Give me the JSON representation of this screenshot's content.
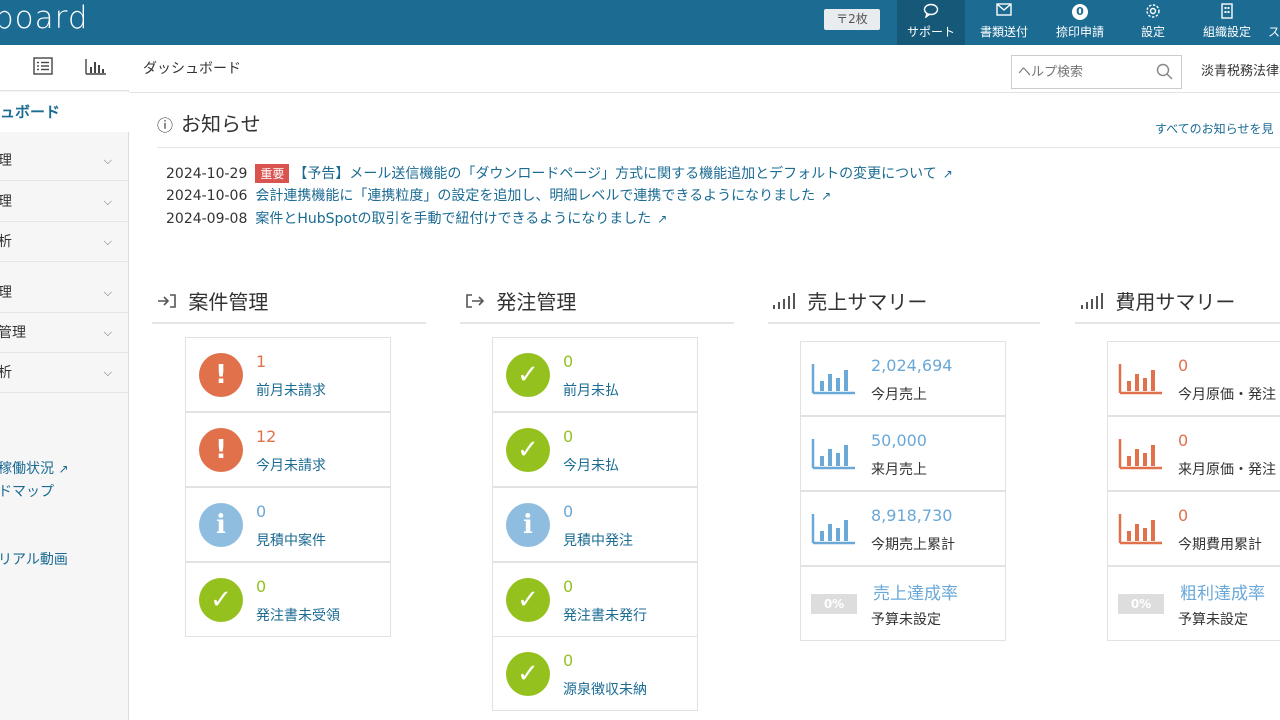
{
  "header": {
    "logo": "board",
    "stamp_chip": "〒2枚",
    "nav": [
      {
        "label": "サポート",
        "icon": "chat-icon"
      },
      {
        "label": "書類送付",
        "icon": "mail-icon"
      },
      {
        "label": "捺印申請",
        "badge": "0"
      },
      {
        "label": "設定",
        "icon": "gear-icon"
      },
      {
        "label": "組織設定",
        "icon": "building-icon"
      },
      {
        "label": "ス"
      }
    ]
  },
  "sidebar": {
    "active": "ュボード",
    "groups1": [
      {
        "label": "理"
      },
      {
        "label": "理"
      },
      {
        "label": "析"
      }
    ],
    "groups2": [
      {
        "label": "理"
      },
      {
        "label": "管理"
      },
      {
        "label": "析"
      }
    ],
    "links": [
      {
        "label": "稼働状況"
      },
      {
        "label": "ドマップ"
      },
      {
        "label": "リアル動画"
      }
    ]
  },
  "main": {
    "breadcrumb": "ダッシュボード",
    "help_search_placeholder": "ヘルプ検索",
    "org_name": "淡青税務法律事"
  },
  "notices": {
    "title": "お知らせ",
    "view_all": "すべてのお知らせを見",
    "important_label": "重要",
    "items": [
      {
        "date": "2024-10-29",
        "important": true,
        "text": "【予告】メール送信機能の「ダウンロードページ」方式に関する機能追加とデフォルトの変更について"
      },
      {
        "date": "2024-10-06",
        "important": false,
        "text": "会計連携機能に「連携粒度」の設定を追加し、明細レベルで連携できるようになりました"
      },
      {
        "date": "2024-09-08",
        "important": false,
        "text": "案件とHubSpotの取引を手動で紐付けできるようになりました"
      }
    ]
  },
  "sections": {
    "projects": {
      "title": "案件管理",
      "cards": [
        {
          "value": "1",
          "label": "前月未請求",
          "status": "alert"
        },
        {
          "value": "12",
          "label": "今月未請求",
          "status": "alert"
        },
        {
          "value": "0",
          "label": "見積中案件",
          "status": "info"
        },
        {
          "value": "0",
          "label": "発注書未受領",
          "status": "ok"
        }
      ]
    },
    "orders": {
      "title": "発注管理",
      "cards": [
        {
          "value": "0",
          "label": "前月未払",
          "status": "ok"
        },
        {
          "value": "0",
          "label": "今月未払",
          "status": "ok"
        },
        {
          "value": "0",
          "label": "見積中発注",
          "status": "info"
        },
        {
          "value": "0",
          "label": "発注書未発行",
          "status": "ok"
        },
        {
          "value": "0",
          "label": "源泉徴収未納",
          "status": "ok"
        }
      ]
    },
    "sales": {
      "title": "売上サマリー",
      "cards": [
        {
          "value": "2,024,694",
          "label": "今月売上"
        },
        {
          "value": "50,000",
          "label": "来月売上"
        },
        {
          "value": "8,918,730",
          "label": "今期売上累計"
        }
      ],
      "rate": {
        "pct": "0%",
        "title": "売上達成率",
        "label": "予算未設定"
      }
    },
    "costs": {
      "title": "費用サマリー",
      "cards": [
        {
          "value": "0",
          "label": "今月原価・発注"
        },
        {
          "value": "0",
          "label": "来月原価・発注"
        },
        {
          "value": "0",
          "label": "今期費用累計"
        }
      ],
      "rate": {
        "pct": "0%",
        "title": "粗利達成率",
        "label": "予算未設定"
      }
    }
  },
  "colors": {
    "brand": "#1b6b93",
    "alert": "#e0714a",
    "info": "#8fbde0",
    "ok": "#95c11f",
    "cost": "#e0714a"
  }
}
